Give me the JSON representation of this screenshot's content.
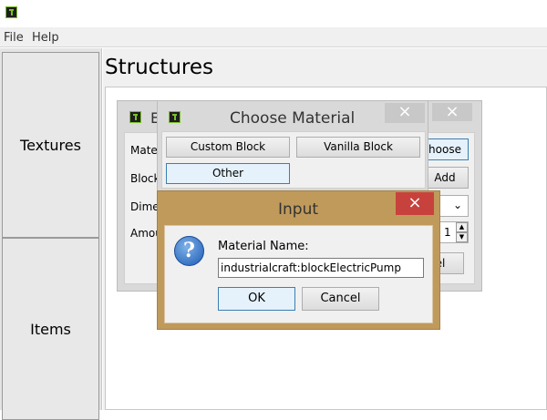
{
  "menubar": {
    "items": [
      "File",
      "Help"
    ]
  },
  "sidebar": {
    "items": [
      {
        "label": "Textures"
      },
      {
        "label": "Items"
      }
    ]
  },
  "main": {
    "title": "Structures"
  },
  "bg_dialog": {
    "title_partial": "E",
    "rows": [
      {
        "label": "Mate"
      },
      {
        "label": "Block"
      },
      {
        "label": "Dime"
      },
      {
        "label": "Amou"
      }
    ],
    "choose_button": "hoose",
    "add_button": "Add",
    "amount_value": "1",
    "cancel_partial": "el"
  },
  "choose_material": {
    "title": "Choose Material",
    "buttons": {
      "custom": "Custom Block",
      "vanilla": "Vanilla Block",
      "other": "Other"
    }
  },
  "input_dialog": {
    "title": "Input",
    "prompt": "Material Name:",
    "value": "industrialcraft:blockElectricPump",
    "ok": "OK",
    "cancel": "Cancel"
  },
  "colors": {
    "input_frame": "#c09a5b",
    "close_red": "#c7423c",
    "close_grey": "#c8c8c8",
    "selected_button": "#e5f1fb"
  }
}
